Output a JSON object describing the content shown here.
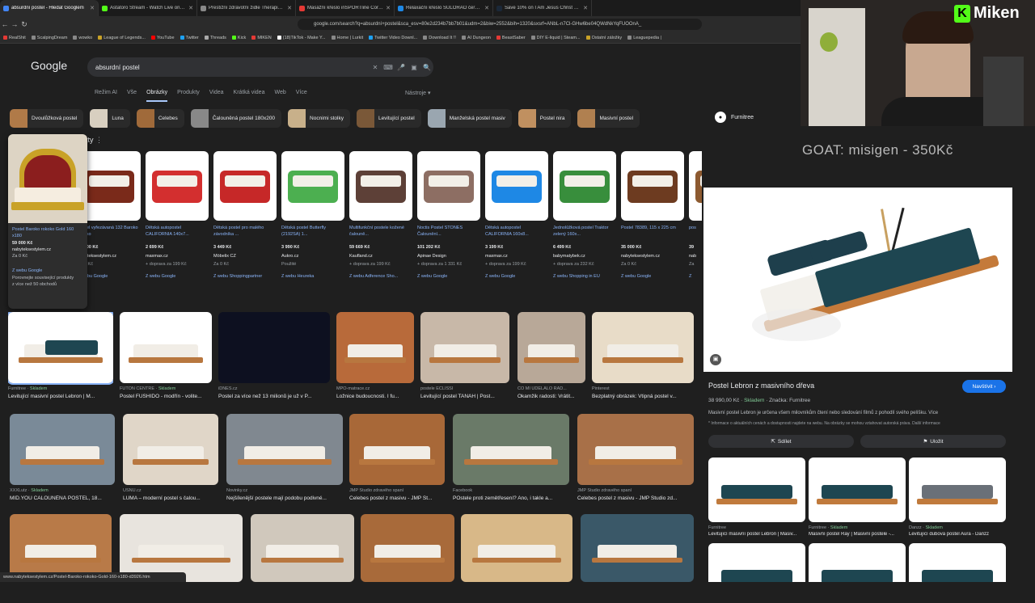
{
  "browser": {
    "tabs": [
      {
        "title": "absurdní postel - Hledat Googlem",
        "color": "#4285f4",
        "active": true
      },
      {
        "title": "Astatoro Stream - Watch Live on Kick",
        "color": "#53fc18"
      },
      {
        "title": "Prestižní zdravotní židle Therapia Eru",
        "color": "#888"
      },
      {
        "title": "Masážní křeslo inSPORTline Cortela",
        "color": "#e53935"
      },
      {
        "title": "Relaxační křeslo SULORAO černá | Sc",
        "color": "#1e88e5"
      },
      {
        "title": "Save 10% on I Am Jesus Christ on Ste",
        "color": "#1b2838"
      }
    ],
    "url": "google.com/search?q=absurdní+postel&sca_esv=80e2d234b7bb7b01&udm=2&biw=2552&bih=1320&sxsrf=ANbL-n7Cl-GHw6be04QWdNkYqFUOOnA_",
    "bookmarks": [
      {
        "label": "RealShit",
        "color": "#e53935"
      },
      {
        "label": "ScalpingDream",
        "color": "#888"
      },
      {
        "label": "wowko",
        "color": "#888"
      },
      {
        "label": "League of Legends...",
        "color": "#c9a227"
      },
      {
        "label": "YouTube",
        "color": "#ff0000"
      },
      {
        "label": "Twitter",
        "color": "#1da1f2"
      },
      {
        "label": "Threads",
        "color": "#aaa"
      },
      {
        "label": "Kick",
        "color": "#53fc18"
      },
      {
        "label": "MIKEN",
        "color": "#e53935"
      },
      {
        "label": "(18)TikTok - Make Y...",
        "color": "#fff"
      },
      {
        "label": "Home | Lurkit",
        "color": "#888"
      },
      {
        "label": "Twitter Video Downl...",
        "color": "#1da1f2"
      },
      {
        "label": "Download It !!",
        "color": "#888"
      },
      {
        "label": "AI Dungeon",
        "color": "#888"
      },
      {
        "label": "BeastSaber",
        "color": "#e53935"
      },
      {
        "label": "DIY E-liquid | Steam...",
        "color": "#888"
      },
      {
        "label": "Ostatní záložky",
        "color": "#c9a227"
      },
      {
        "label": "Leaguepedia |",
        "color": "#888"
      }
    ],
    "status_url": "www.nabyteksestylem.cz/Postel-Baroko-rokoko-Gold-160-x180-d3926.htm"
  },
  "search": {
    "logo": "Google",
    "query": "absurdní postel",
    "tabs": [
      "Režim AI",
      "Vše",
      "Obrázky",
      "Produkty",
      "Videa",
      "Krátká videa",
      "Web",
      "Více"
    ],
    "active_tab": "Obrázky",
    "tools": "Nástroje"
  },
  "chips": [
    {
      "label": "Dvoulůžková postel",
      "color": "#b07a48"
    },
    {
      "label": "Luna",
      "color": "#d8cfc0"
    },
    {
      "label": "Celebes",
      "color": "#a06a3a"
    },
    {
      "label": "Čalouněná postel 180x200",
      "color": "#888"
    },
    {
      "label": "Nocnimi stolky",
      "color": "#c8b08a"
    },
    {
      "label": "Levitující postel",
      "color": "#7a5838"
    },
    {
      "label": "Manželská postel masiv",
      "color": "#9aa6b0"
    },
    {
      "label": "Postel nira",
      "color": "#c09060"
    },
    {
      "label": "Masivní postel",
      "color": "#b08050"
    }
  ],
  "products_header": "kty",
  "popup": {
    "title": "Postel Baroko rokoko Gold 160 x180",
    "price": "59 000 Kč",
    "store": "nabyteksestylem.cz",
    "shipping": "Za 0 Kč",
    "source": "Z webu Google",
    "note1": "Porovnejte související produkty",
    "note2": "z více než 50 obchodů"
  },
  "products": [
    {
      "title": "Postel vyřezávaná 132 Baroko rokoko",
      "price": "41 900 Kč",
      "store": "nabyteksestylem.cz",
      "shipping": "Za 0 Kč",
      "source": "Z webu Google",
      "color": "#7a2a1a"
    },
    {
      "title": "Dětská autopostel CALIFORNIA 140x7...",
      "price": "2 699 Kč",
      "store": "maxmax.cz",
      "shipping": "+ doprava za 199 Kč",
      "source": "Z webu Google",
      "color": "#d32f2f"
    },
    {
      "title": "Dětská postel pro malého závodníka ...",
      "price": "3 449 Kč",
      "store": "Möbelix CZ",
      "shipping": "Za 0 Kč",
      "source": "Z webu Shoppingpartner",
      "color": "#c62828"
    },
    {
      "title": "Dětská postel Butterfly (2192SA) 1...",
      "price": "3 990 Kč",
      "store": "Aukro.cz",
      "shipping": "Použité",
      "source": "Z webu Heureka",
      "color": "#4caf50"
    },
    {
      "title": "Multifunkční postele kožené čalouně...",
      "price": "59 669 Kč",
      "store": "Kaufland.cz",
      "shipping": "+ doprava za 199 Kč",
      "source": "Z webu Adference Sho...",
      "color": "#5d4037"
    },
    {
      "title": "Noctis Postel STONES Čalounění...",
      "price": "101 202 Kč",
      "store": "Apinae Design",
      "shipping": "+ doprava za 1 331 Kč",
      "source": "Z webu Google",
      "color": "#8d6e63"
    },
    {
      "title": "Dětská autopostel CALIFORNIA 160x8...",
      "price": "3 199 Kč",
      "store": "maxmax.cz",
      "shipping": "+ doprava za 199 Kč",
      "source": "Z webu Google",
      "color": "#1e88e5"
    },
    {
      "title": "Jednolůžková postel Traktor zelený 160x...",
      "price": "6 499 Kč",
      "store": "babymatybek.cz",
      "shipping": "+ doprava za 232 Kč",
      "source": "Z webu Shopping in EU",
      "color": "#388e3c"
    },
    {
      "title": "Postel 78389, 115 x 225 cm",
      "price": "35 000 Kč",
      "store": "nabyteksestylem.cz",
      "shipping": "Za 0 Kč",
      "source": "Z webu Google",
      "color": "#6d3b20"
    },
    {
      "title": "pos",
      "price": "39",
      "store": "nab",
      "shipping": "Za",
      "source": "Z",
      "color": "#8d5a30"
    }
  ],
  "images": [
    {
      "source": "Furnitree",
      "stock": "Skladem",
      "title": "Levitující masivní postel Lebron | M...",
      "color": "#ffffff"
    },
    {
      "source": "FUTON CENTRE",
      "stock": "Skladem",
      "title": "Postel FUSHIDO - modřín - volite...",
      "color": "#ffffff"
    },
    {
      "source": "iDNES.cz",
      "stock": "",
      "title": "Postel za více než 13 milionů je už v P...",
      "color": "#0d1020"
    },
    {
      "source": "MPO-matrace.cz",
      "stock": "",
      "title": "Ložnice budoucnosti. I fu...",
      "color": "#b86a3a"
    },
    {
      "source": "postele ECLISSI",
      "stock": "",
      "title": "Levitující postel TANAH | Post...",
      "color": "#c8b8a8"
    },
    {
      "source": "CO MI UDĚLALO RAD...",
      "stock": "",
      "title": "Okamžik radosti: Vrátit...",
      "color": "#b8a898"
    },
    {
      "source": "Pinterest",
      "stock": "",
      "title": "Bezplatný obrázek: Vtipná postel v...",
      "color": "#e8dcc8"
    },
    {
      "source": "XXXLutz",
      "stock": "Skladem",
      "title": "MID.YOU ČALOUNĚNÁ POSTEL, 18...",
      "color": "#7a8a98"
    },
    {
      "source": "USNU.cz",
      "stock": "",
      "title": "LUMA – moderní postel s čalou...",
      "color": "#e0d6c8"
    },
    {
      "source": "Novinky.cz",
      "stock": "",
      "title": "Nejšílenější postele mají podobu podivné...",
      "color": "#808890"
    },
    {
      "source": "JMP Studio zdravého spaní",
      "stock": "",
      "title": "Celebes postel z masivu - JMP St...",
      "color": "#a86838"
    },
    {
      "source": "Facebook",
      "stock": "",
      "title": "POstele proti zemětřesení? Ano, i takle a...",
      "color": "#6a7a68"
    },
    {
      "source": "JMP Studio zdravého spaní",
      "stock": "",
      "title": "Celebes postel z masivu - JMP Studio zd...",
      "color": "#a87048"
    },
    {
      "source": "",
      "stock": "",
      "title": "",
      "color": "#b87a48"
    },
    {
      "source": "",
      "stock": "",
      "title": "",
      "color": "#e8e4de"
    },
    {
      "source": "",
      "stock": "",
      "title": "",
      "color": "#d0c8bc"
    },
    {
      "source": "",
      "stock": "",
      "title": "",
      "color": "#a86a3a"
    },
    {
      "source": "",
      "stock": "",
      "title": "",
      "color": "#d8b888"
    },
    {
      "source": "",
      "stock": "",
      "title": "",
      "color": "#3a5868"
    }
  ],
  "panel": {
    "brand": "Furnitree",
    "title": "Postel Lebron z masivního dřeva",
    "visit": "Navštívit",
    "price": "38 990,00 Kč",
    "stock": "Skladem",
    "brand_line": "Značka: Furnitree",
    "description": "Masivní postel Lebron je určena všem milovníkům čtení nebo sledování filmů z pohodlí svého pelíšku. Více",
    "info": "* Informace o aktuálních cenách a dostupnosti najdete na webu. Na obrázky se mohou vztahovat autorská práva. Další informace",
    "share": "Sdílet",
    "save": "Uložit",
    "related": [
      {
        "source": "Furnitree",
        "stock": "",
        "title": "Levitující masivní postel Lebron | Masiv..."
      },
      {
        "source": "Furnitree",
        "stock": "Skladem",
        "title": "Masivní postel Ray | Masivní postele -..."
      },
      {
        "source": "Danzz",
        "stock": "Skladem",
        "title": "Levitující dubová postel Aura - Danzz"
      },
      {
        "source": "",
        "stock": "",
        "title": ""
      },
      {
        "source": "",
        "stock": "",
        "title": ""
      },
      {
        "source": "",
        "stock": "",
        "title": ""
      }
    ]
  },
  "overlay": {
    "streamer": "Miken",
    "goat_text": "GOAT: misigen - 350Kč"
  }
}
